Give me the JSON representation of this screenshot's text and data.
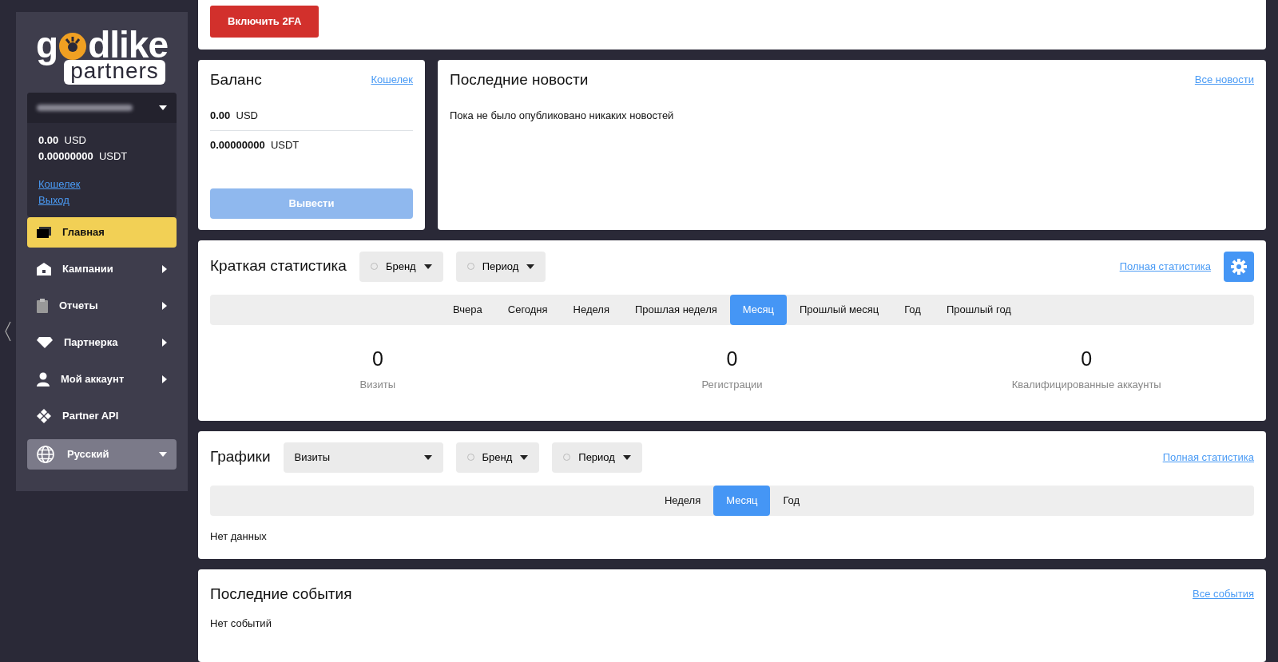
{
  "top_card": {
    "button": "Включить 2FA"
  },
  "sidebar": {
    "logo": {
      "before": "g",
      "after": "dlike",
      "badge": "partners"
    },
    "account": {
      "balances": [
        {
          "amount": "0.00",
          "currency": "USD"
        },
        {
          "amount": "0.00000000",
          "currency": "USDT"
        }
      ],
      "links": [
        "Кошелек",
        "Выход"
      ]
    },
    "items": [
      {
        "label": "Главная",
        "selected": true,
        "submenu": false
      },
      {
        "label": "Кампании",
        "selected": false,
        "submenu": true
      },
      {
        "label": "Отчеты",
        "selected": false,
        "submenu": true
      },
      {
        "label": "Партнерка",
        "selected": false,
        "submenu": true
      },
      {
        "label": "Мой аккаунт",
        "selected": false,
        "submenu": true
      },
      {
        "label": "Partner API",
        "selected": false,
        "submenu": false
      }
    ],
    "language": {
      "value": "Русский"
    }
  },
  "balance": {
    "title": "Баланс",
    "link": "Кошелек",
    "rows": [
      {
        "amount": "0.00",
        "currency": "USD"
      },
      {
        "amount": "0.00000000",
        "currency": "USDT"
      }
    ],
    "button": {
      "label": "Вывести",
      "disabled": true
    }
  },
  "news": {
    "title": "Последние новости",
    "link": "Все новости",
    "empty": "Пока не было опубликовано никаких новостей"
  },
  "stats": {
    "title": "Краткая статистика",
    "filters": [
      "Бренд",
      "Период"
    ],
    "link": "Полная статистика",
    "periods": [
      {
        "label": "Вчера",
        "selected": false
      },
      {
        "label": "Сегодня",
        "selected": false
      },
      {
        "label": "Неделя",
        "selected": false
      },
      {
        "label": "Прошлая неделя",
        "selected": false
      },
      {
        "label": "Месяц",
        "selected": true
      },
      {
        "label": "Прошлый месяц",
        "selected": false
      },
      {
        "label": "Год",
        "selected": false
      },
      {
        "label": "Прошлый год",
        "selected": false
      }
    ],
    "metrics": [
      {
        "value": "0",
        "label": "Визиты"
      },
      {
        "value": "0",
        "label": "Регистрации"
      },
      {
        "value": "0",
        "label": "Квалифицированные аккаунты"
      }
    ]
  },
  "charts": {
    "title": "Графики",
    "metric_select": "Визиты",
    "filters": [
      "Бренд",
      "Период"
    ],
    "link": "Полная статистика",
    "periods": [
      {
        "label": "Неделя",
        "selected": false
      },
      {
        "label": "Месяц",
        "selected": true
      },
      {
        "label": "Год",
        "selected": false
      }
    ],
    "empty": "Нет данных"
  },
  "events": {
    "title": "Последние события",
    "link": "Все события",
    "empty": "Нет событий"
  }
}
